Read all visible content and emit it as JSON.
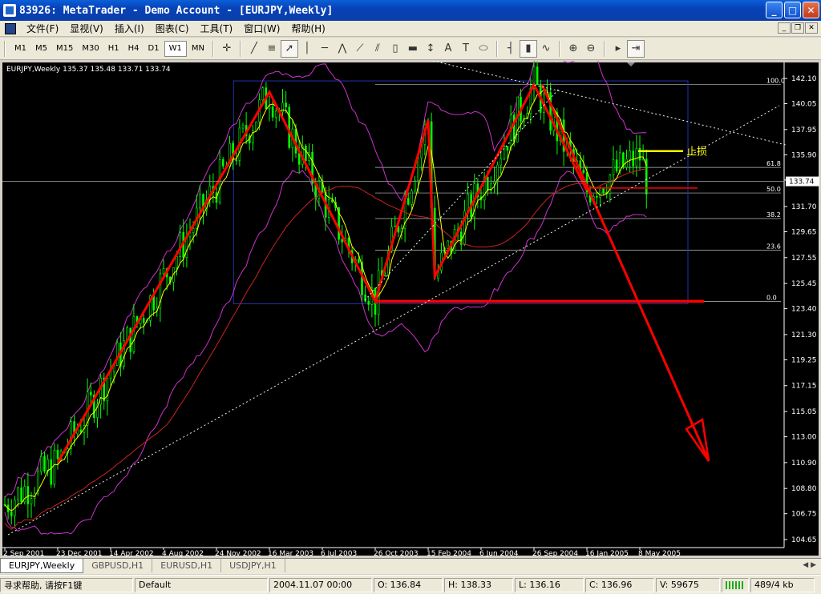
{
  "window": {
    "title": "83926: MetaTrader - Demo Account - [EURJPY,Weekly]"
  },
  "menu": [
    "文件(F)",
    "显视(V)",
    "插入(I)",
    "图表(C)",
    "工具(T)",
    "窗口(W)",
    "帮助(H)"
  ],
  "timeframes": [
    "M1",
    "M5",
    "M15",
    "M30",
    "H1",
    "H4",
    "D1",
    "W1",
    "MN"
  ],
  "active_timeframe": "W1",
  "chart": {
    "header": "EURJPY,Weekly  135.37 135.48 133.71 133.74",
    "current_price": "133.74",
    "annotation_label": "止损",
    "fib_levels": [
      "100.0",
      "61.8",
      "50.0",
      "38.2",
      "23.6",
      "0.0"
    ],
    "colors": {
      "background": "#000000",
      "candles": "#00ff00",
      "trend": "#ff0000",
      "bands": "#cc33cc",
      "ma": "#ffff00",
      "grid": "#ffffff"
    }
  },
  "chart_data": {
    "type": "candlestick",
    "title": "EURJPY,Weekly",
    "y_ticks": [
      "142.10",
      "140.05",
      "137.95",
      "135.90",
      "133.85",
      "131.70",
      "129.65",
      "127.55",
      "125.45",
      "123.40",
      "121.30",
      "119.25",
      "117.15",
      "115.05",
      "113.00",
      "110.90",
      "108.80",
      "106.75",
      "104.65"
    ],
    "x_ticks": [
      "2 Sep 2001",
      "23 Dec 2001",
      "14 Apr 2002",
      "4 Aug 2002",
      "24 Nov 2002",
      "16 Mar 2003",
      "6 Jul 2003",
      "26 Oct 2003",
      "15 Feb 2004",
      "6 Jun 2004",
      "26 Sep 2004",
      "16 Jan 2005",
      "8 May 2005"
    ],
    "ylim": [
      104.65,
      142.1
    ],
    "last_ohlc": {
      "open": 135.37,
      "high": 135.48,
      "low": 133.71,
      "close": 133.74
    },
    "trend_pivots": [
      {
        "date": "23 Dec 2001",
        "price": 110.9
      },
      {
        "date": "16 Mar 2003",
        "price": 141.0
      },
      {
        "date": "26 Oct 2003",
        "price": 124.0
      },
      {
        "date": "15 Feb 2004",
        "price": 138.7
      },
      {
        "date": "29 Feb 2004",
        "price": 126.0
      },
      {
        "date": "26 Sep 2004",
        "price": 141.6
      },
      {
        "date": "16 Jan 2005",
        "price": 133.0
      }
    ],
    "stop_level": 136.2,
    "neckline": 124.0,
    "series_note": "weekly candles"
  },
  "tabs": [
    "EURJPY,Weekly",
    "GBPUSD,H1",
    "EURUSD,H1",
    "USDJPY,H1"
  ],
  "status": {
    "help": "寻求帮助, 请按F1键",
    "profile": "Default",
    "time": "2004.11.07 00:00",
    "open": "O: 136.84",
    "high": "H: 138.33",
    "low": "L: 136.16",
    "close": "C: 136.96",
    "volume": "V: 59675",
    "traffic": "489/4 kb"
  }
}
